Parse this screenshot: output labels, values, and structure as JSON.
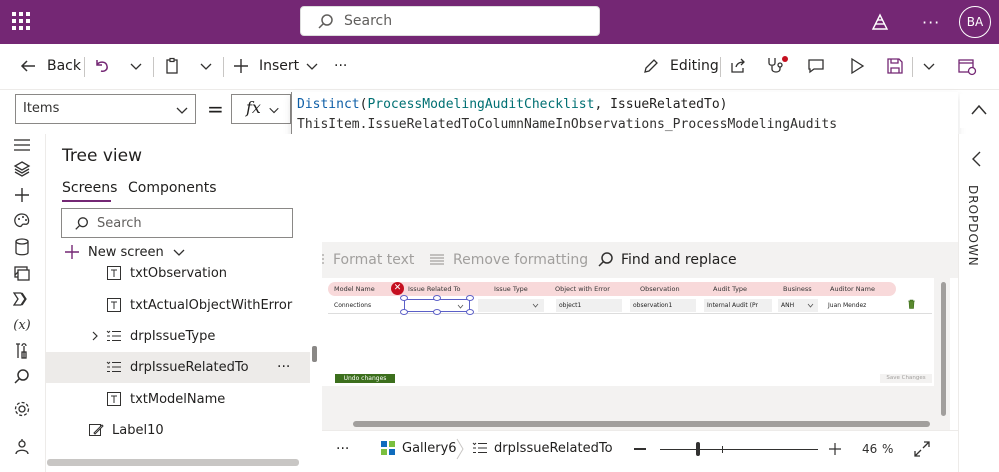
{
  "topbar": {
    "search_placeholder": "Search",
    "avatar_initials": "BA"
  },
  "commands": {
    "back": "Back",
    "insert": "Insert",
    "more": "···",
    "editing": "Editing"
  },
  "formula": {
    "property": "Items",
    "equals": "=",
    "fx": "fx",
    "line1": {
      "fn": "Distinct",
      "open": "(",
      "source": "ProcessModelingAuditChecklist",
      "sep": ", ",
      "column": "IssueRelatedTo",
      "close": ")"
    },
    "line2": "ThisItem.IssueRelatedToColumnNameInObservations_ProcessModelingAudits",
    "toolbar": {
      "format": "Format text",
      "remove": "Remove formatting",
      "find": "Find and replace"
    }
  },
  "tree": {
    "title": "Tree view",
    "tabs": {
      "screens": "Screens",
      "components": "Components"
    },
    "search_placeholder": "Search",
    "new_screen": "New screen",
    "nodes": [
      "txtObservation",
      "txtActualObjectWithError",
      "drpIssueType",
      "drpIssueRelatedTo",
      "txtModelName",
      "Label10"
    ],
    "node_more": "···"
  },
  "gallery": {
    "headers": [
      "Model Name",
      "Issue Related To",
      "Issue Type",
      "Object with Error",
      "Observation",
      "Audit Type",
      "Business",
      "Auditor Name"
    ],
    "row": {
      "model": "Connections",
      "object": "object1",
      "observation": "observation1",
      "audit_type": "Internal Audit (Pr",
      "business": "ANH",
      "auditor": "Juan Mendez"
    },
    "undo": "Undo changes",
    "save": "Save Changes"
  },
  "right_panel": {
    "label": "DROPDOWN"
  },
  "status": {
    "more": "···",
    "gallery": "Gallery6",
    "control": "drpIssueRelatedTo",
    "zoom_value": "46",
    "zoom_unit": "%",
    "zoom_level": 46
  },
  "colors": {
    "brand": "#742774",
    "accent_green": "#3c6f1d",
    "error_red": "#c50f1f"
  }
}
